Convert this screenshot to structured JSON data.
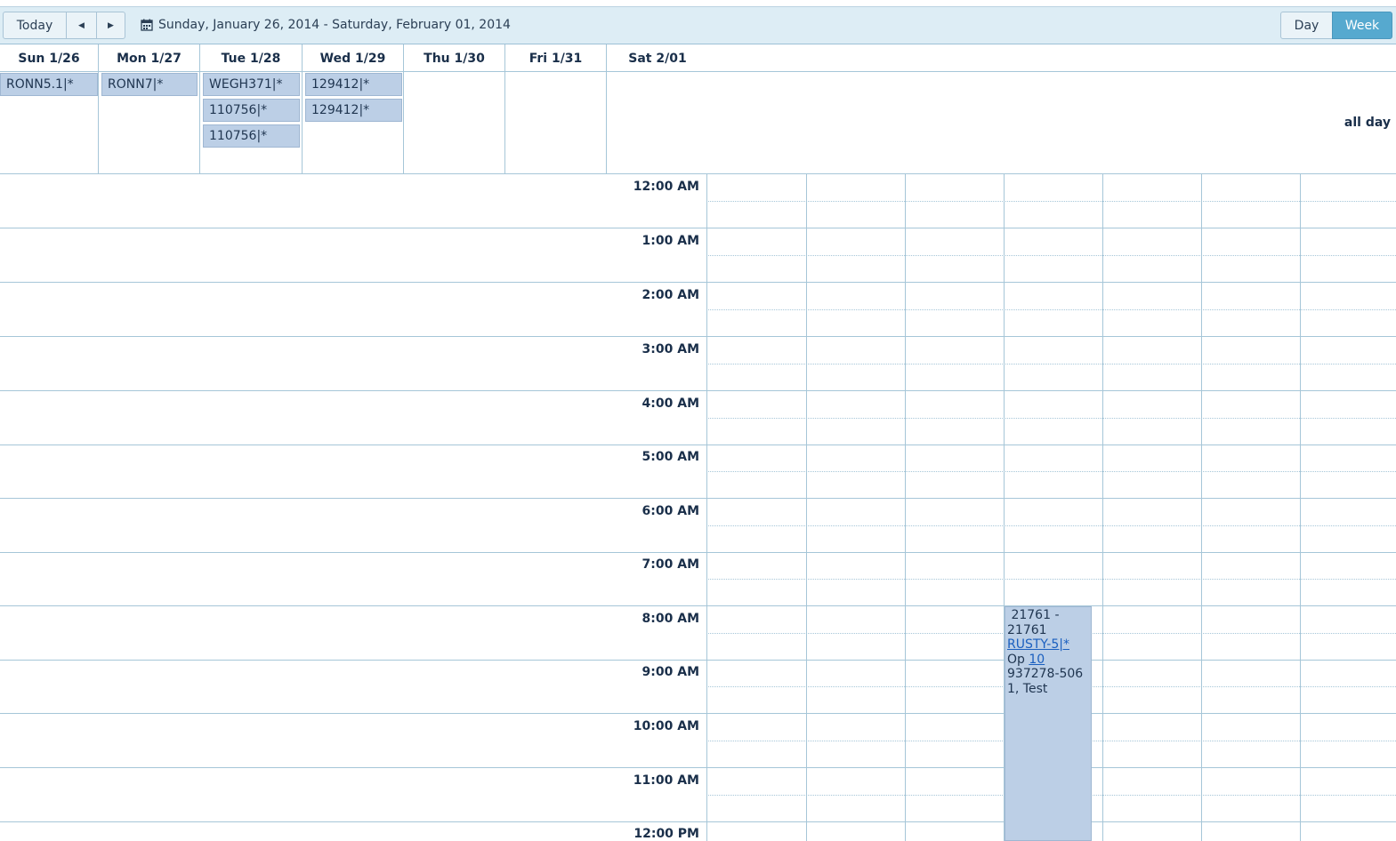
{
  "toolbar": {
    "today_label": "Today",
    "prev_icon": "triangle-left",
    "next_icon": "triangle-right",
    "date_range": "Sunday, January 26, 2014 - Saturday, February 01, 2014",
    "day_label": "Day",
    "week_label": "Week",
    "active_view": "Week"
  },
  "days": [
    "Sun 1/26",
    "Mon 1/27",
    "Tue 1/28",
    "Wed 1/29",
    "Thu 1/30",
    "Fri 1/31",
    "Sat 2/01"
  ],
  "allday": {
    "label": "all day",
    "events": {
      "sun": [
        "RONN5.1|*"
      ],
      "mon": [
        "RONN7|*"
      ],
      "tue": [
        "WEGH371|*",
        "110756|*",
        "110756|*"
      ],
      "wed": [
        "129412|*",
        "129412|*"
      ]
    }
  },
  "hours": [
    "12:00 AM",
    "1:00 AM",
    "2:00 AM",
    "3:00 AM",
    "4:00 AM",
    "5:00 AM",
    "6:00 AM",
    "7:00 AM",
    "8:00 AM",
    "9:00 AM",
    "10:00 AM",
    "11:00 AM",
    "12:00 PM"
  ],
  "appointment": {
    "range_line1": "21761 -",
    "range_line2": "21761",
    "link": "RUSTY-5|*",
    "op_label": "Op",
    "op_link": "10",
    "phone_line1": "937278-506",
    "phone_line2": "1, Test"
  },
  "colors": {
    "toolbar_bg": "#ddedf5",
    "active_button": "#56a9cf",
    "event_bg": "#bccfe6",
    "grid_line": "#a6c6d8"
  }
}
